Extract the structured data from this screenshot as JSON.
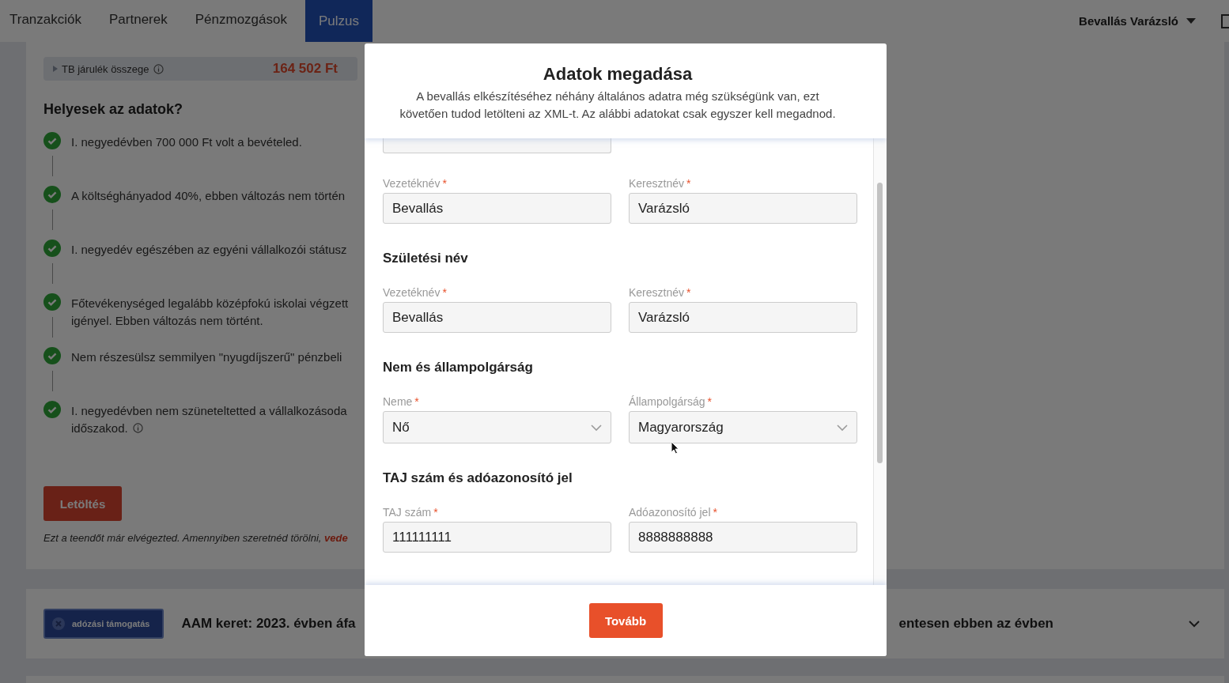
{
  "nav": {
    "tabs": [
      {
        "label": "Tranzakciók",
        "selected": false
      },
      {
        "label": "Partnerek",
        "selected": false
      },
      {
        "label": "Pénzmozgások",
        "selected": false
      },
      {
        "label": "Pulzus",
        "selected": true
      }
    ],
    "user_menu": "Bevallás Varázsló"
  },
  "summary": {
    "label": "TB járulék összege",
    "amount": "164 502 Ft"
  },
  "checklist": {
    "title": "Helyesek az adatok?",
    "items": [
      {
        "lines": [
          "I. negyedévben 700 000 Ft volt a bevételed."
        ],
        "checked": true,
        "info": false
      },
      {
        "lines": [
          "A költséghányadod 40%, ebben változás nem történ"
        ],
        "checked": true,
        "info": false
      },
      {
        "lines": [
          "I. negyedév egészében az egyéni vállalkozói státusz"
        ],
        "checked": true,
        "info": false
      },
      {
        "lines": [
          "Főtevékenységed legalább középfokú iskolai végzett",
          "igényel. Ebben változás nem történt."
        ],
        "checked": true,
        "info": false
      },
      {
        "lines": [
          "Nem részesülsz semmilyen \"nyugdíjszerű\" pénzbeli"
        ],
        "checked": true,
        "info": false
      },
      {
        "lines": [
          "I. negyedévben nem szüneteltetted a vállalkozásoda",
          "időszakod."
        ],
        "checked": true,
        "info": true
      }
    ]
  },
  "download_button": "Letöltés",
  "note": {
    "text": "Ezt a teendőt már elvégezted. Amennyiben szeretnéd törölni,",
    "link": "vede"
  },
  "aam_card": {
    "badge": "adózási támogatás",
    "title_left": "AAM keret: 2023. évben áfa",
    "title_right": "entesen ebben az évben",
    "expanded": false
  },
  "modal": {
    "title": "Adatok megadása",
    "subtitle": "A bevallás elkészítéséhez néhány általános adatra még szükségünk van, ezt követően tudod letölteni az XML-t. Az alábbi adatokat csak egyszer kell megadnod.",
    "sections": [
      {
        "fields": [
          {
            "kind": "input",
            "label": "Vezetéknév",
            "required_mark": "*",
            "value": "Bevallás"
          },
          {
            "kind": "input",
            "label": "Keresztnév",
            "required_mark": "*",
            "value": "Varázsló"
          }
        ]
      },
      {
        "heading": "Születési név",
        "fields": [
          {
            "kind": "input",
            "label": "Vezetéknév",
            "required_mark": "*",
            "value": "Bevallás"
          },
          {
            "kind": "input",
            "label": "Keresztnév",
            "required_mark": "*",
            "value": "Varázsló"
          }
        ]
      },
      {
        "heading": "Nem és állampolgárság",
        "fields": [
          {
            "kind": "select",
            "label": "Neme",
            "required_mark": "*",
            "value": "Nő"
          },
          {
            "kind": "select",
            "label": "Állampolgárság",
            "required_mark": "*",
            "value": "Magyarország"
          }
        ]
      },
      {
        "heading": "TAJ szám és adóazonosító jel",
        "fields": [
          {
            "kind": "input",
            "label": "TAJ szám",
            "required_mark": "*",
            "value": "111111111"
          },
          {
            "kind": "input",
            "label": "Adóazonosító jel",
            "required_mark": "*",
            "value": "8888888888"
          }
        ]
      }
    ],
    "button": "Tovább"
  }
}
